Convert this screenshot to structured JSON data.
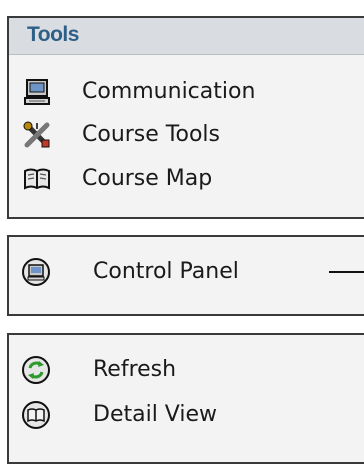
{
  "tools_panel": {
    "title": "Tools",
    "items": [
      {
        "label": "Communication",
        "icon": "monitor-icon"
      },
      {
        "label": "Course Tools",
        "icon": "tools-icon"
      },
      {
        "label": "Course Map",
        "icon": "book-icon"
      }
    ]
  },
  "control_panel": {
    "items": [
      {
        "label": "Control Panel",
        "icon": "control-panel-icon"
      }
    ]
  },
  "view_panel": {
    "items": [
      {
        "label": "Refresh",
        "icon": "refresh-icon"
      },
      {
        "label": "Detail View",
        "icon": "detail-view-icon"
      }
    ]
  },
  "colors": {
    "header_bg": "#d9dde1",
    "title_text": "#2e5f86",
    "panel_bg": "#f3f3f3",
    "border": "#3a3a3a",
    "refresh_green": "#2e9a2e"
  }
}
